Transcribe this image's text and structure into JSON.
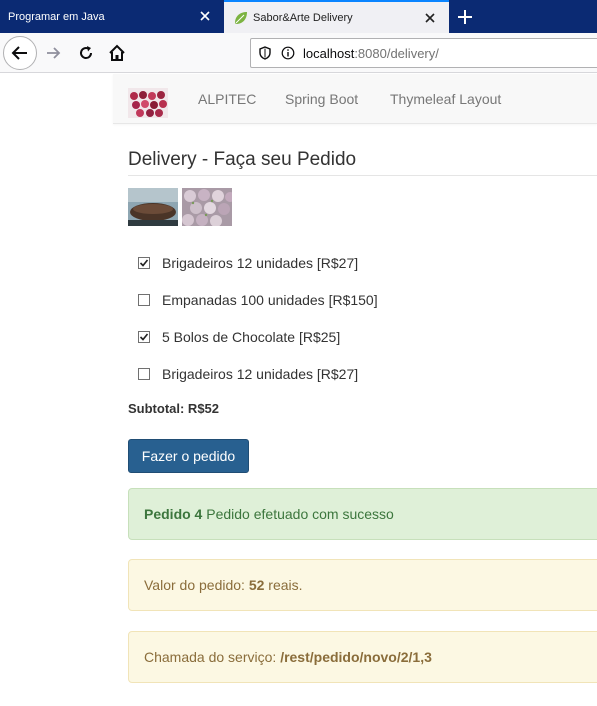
{
  "browser": {
    "tabs": [
      {
        "title": "Programar em Java",
        "active": false
      },
      {
        "title": "Sabor&Arte Delivery",
        "active": true
      }
    ],
    "url_host": "localhost",
    "url_rest": ":8080/delivery/"
  },
  "site_nav": {
    "links": [
      "ALPITEC",
      "Spring Boot",
      "Thymeleaf Layout"
    ]
  },
  "page": {
    "title": "Delivery - Faça seu Pedido",
    "items": [
      {
        "label": "Brigadeiros 12 unidades [R$27]",
        "checked": true
      },
      {
        "label": "Empanadas 100 unidades [R$150]",
        "checked": false
      },
      {
        "label": "5 Bolos de Chocolate [R$25]",
        "checked": true
      },
      {
        "label": "Brigadeiros 12 unidades [R$27]",
        "checked": false
      }
    ],
    "subtotal": "Subtotal: R$52",
    "order_button": "Fazer o pedido"
  },
  "alerts": {
    "success_strong": "Pedido 4",
    "success_text": " Pedido efetuado com sucesso",
    "value_prefix": "Valor do pedido: ",
    "value_amount": "52",
    "value_suffix": " reais.",
    "service_prefix": "Chamada do serviço: ",
    "service_path": "/rest/pedido/novo/2/1,3"
  },
  "colors": {
    "tabstrip": "#0b2a73",
    "primary_button": "#286090",
    "success_bg": "#dff0d8",
    "warning_bg": "#fcf8e3"
  }
}
